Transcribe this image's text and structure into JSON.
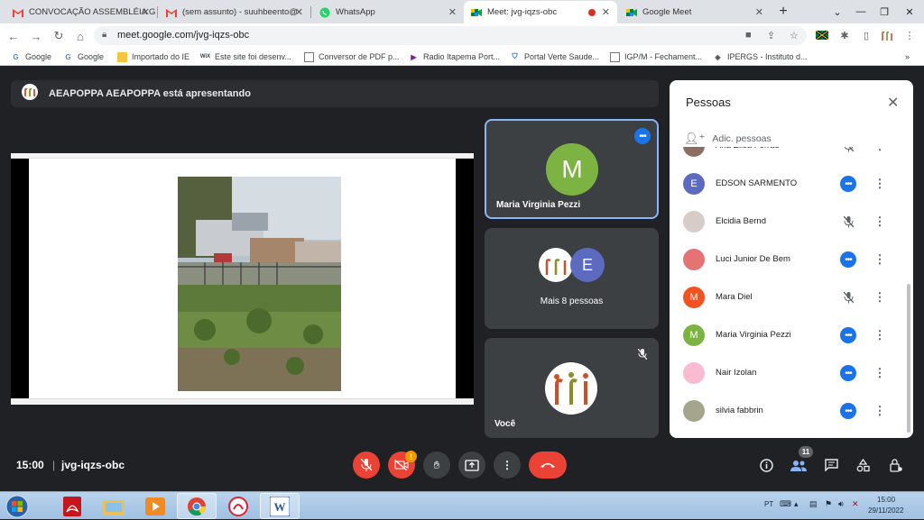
{
  "browser": {
    "tabs": [
      {
        "title": "CONVOCAÇÃO ASSEMBLÉIA G",
        "icon": "gmail-icon"
      },
      {
        "title": "(sem assunto) - suuhbeento@",
        "icon": "gmail-icon"
      },
      {
        "title": "WhatsApp",
        "icon": "whatsapp-icon"
      },
      {
        "title": "Meet: jvg-iqzs-obc",
        "icon": "meet-icon",
        "active": true,
        "recording": true
      },
      {
        "title": "Google Meet",
        "icon": "meet-icon"
      }
    ],
    "url": "meet.google.com/jvg-iqzs-obc",
    "bookmarks": [
      "Google",
      "Google",
      "Importado do IE",
      "Este site foi desenv...",
      "Conversor de PDF p...",
      "Radio Itapema Port...",
      "Portal Verte Saude...",
      "IGP/M - Fechament...",
      "IPERGS - Instituto d..."
    ],
    "bookmarks_more": "»"
  },
  "meet": {
    "presenting_text": "AEAPOPPA AEAPOPPA está apresentando",
    "tiles": {
      "speaker": {
        "name": "Maria Virginia Pezzi",
        "initial": "M",
        "color": "#7cb342"
      },
      "group": {
        "label": "Mais 8 pessoas",
        "initial": "E",
        "color": "#5c6bc0"
      },
      "self": {
        "label": "Você"
      }
    },
    "people_panel": {
      "title": "Pessoas",
      "add_label": "Adic. pessoas",
      "people": [
        {
          "name": "Ana Elisa Ferrão",
          "initial": "",
          "color": "#8d6e63",
          "status": "muted"
        },
        {
          "name": "EDSON SARMENTO",
          "initial": "E",
          "color": "#5c6bc0",
          "status": "speaking"
        },
        {
          "name": "Elcidia Bernd",
          "initial": "",
          "color": "#d7ccc8",
          "status": "muted"
        },
        {
          "name": "Luci Junior De Bem",
          "initial": "",
          "color": "#e57373",
          "status": "speaking"
        },
        {
          "name": "Mara Diel",
          "initial": "M",
          "color": "#f4511e",
          "status": "muted"
        },
        {
          "name": "Maria Virginia Pezzi",
          "initial": "M",
          "color": "#7cb342",
          "status": "speaking"
        },
        {
          "name": "Nair Izolan",
          "initial": "",
          "color": "#f8bbd0",
          "status": "speaking"
        },
        {
          "name": "silvia fabbrin",
          "initial": "",
          "color": "#a5a58d",
          "status": "speaking"
        }
      ]
    },
    "bottom": {
      "time": "15:00",
      "separator": "|",
      "meeting_code": "jvg-iqzs-obc",
      "participant_count": "11",
      "warning_badge": "!"
    }
  },
  "taskbar": {
    "lang": "PT",
    "time": "15:00",
    "date": "29/11/2022"
  },
  "colors": {
    "meet_bg": "#202124",
    "tile_bg": "#3c4043",
    "accent_blue": "#1a73e8",
    "end_call_red": "#ea4335"
  }
}
